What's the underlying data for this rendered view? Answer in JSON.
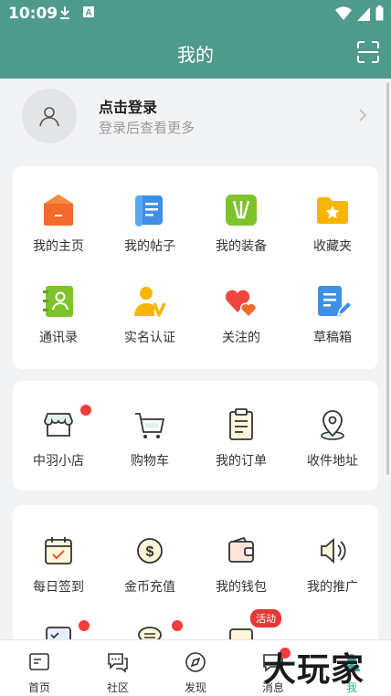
{
  "status_bar": {
    "time": "10:09"
  },
  "header": {
    "title": "我的"
  },
  "login": {
    "title": "点击登录",
    "subtitle": "登录后查看更多"
  },
  "card1": {
    "items": [
      {
        "label": "我的主页",
        "icon": "home-icon",
        "color": "#f26a2c"
      },
      {
        "label": "我的帖子",
        "icon": "post-icon",
        "color": "#3f8fe5"
      },
      {
        "label": "我的装备",
        "icon": "racket-icon",
        "color": "#7dc42a"
      },
      {
        "label": "收藏夹",
        "icon": "folder-star-icon",
        "color": "#f7b500"
      },
      {
        "label": "通讯录",
        "icon": "contacts-icon",
        "color": "#7dc42a"
      },
      {
        "label": "实名认证",
        "icon": "verify-icon",
        "color": "#f7b500"
      },
      {
        "label": "关注的",
        "icon": "hearts-icon",
        "color": "#f2453d"
      },
      {
        "label": "草稿箱",
        "icon": "draft-icon",
        "color": "#3f8fe5"
      }
    ]
  },
  "card2": {
    "items": [
      {
        "label": "中羽小店",
        "icon": "shop-icon",
        "dot": true
      },
      {
        "label": "购物车",
        "icon": "cart-icon"
      },
      {
        "label": "我的订单",
        "icon": "order-icon"
      },
      {
        "label": "收件地址",
        "icon": "location-icon"
      }
    ]
  },
  "card3": {
    "items": [
      {
        "label": "每日签到",
        "icon": "calendar-check-icon"
      },
      {
        "label": "金币充值",
        "icon": "coin-icon"
      },
      {
        "label": "我的钱包",
        "icon": "wallet-icon"
      },
      {
        "label": "我的推广",
        "icon": "speaker-icon"
      }
    ],
    "partial_badge": "活动"
  },
  "tabbar": {
    "tabs": [
      {
        "label": "首页",
        "icon": "home-tab-icon"
      },
      {
        "label": "社区",
        "icon": "community-icon"
      },
      {
        "label": "发现",
        "icon": "compass-icon"
      },
      {
        "label": "消息",
        "icon": "message-icon"
      },
      {
        "label": "我",
        "icon": "me-icon",
        "active": true
      }
    ]
  },
  "watermark": "大玩家"
}
